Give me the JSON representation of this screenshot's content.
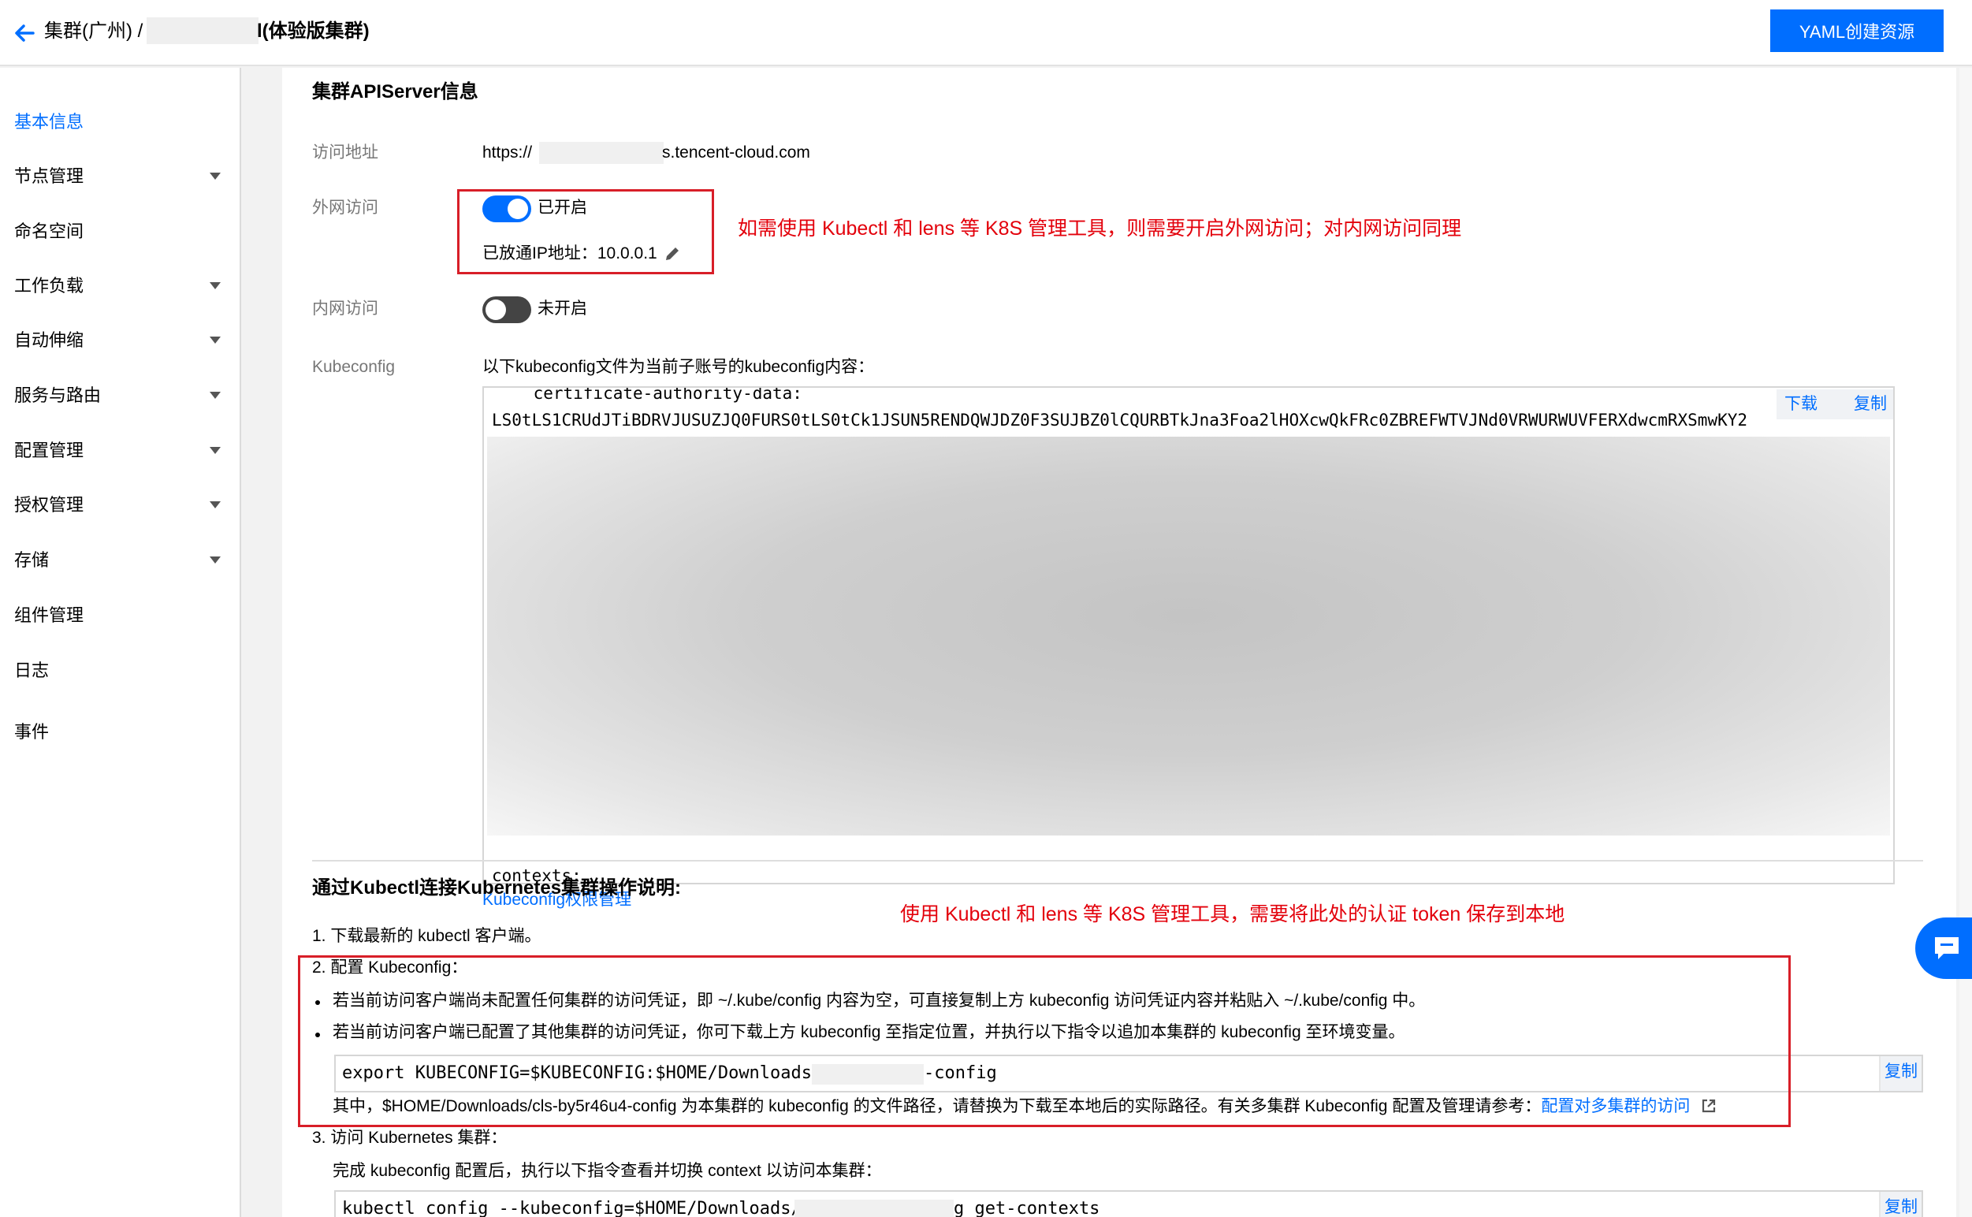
{
  "header": {
    "breadcrumb_prefix": "集群(广州) /",
    "cluster_title": "l(体验版集群)",
    "yaml_button": "YAML创建资源"
  },
  "sidebar": {
    "items": [
      {
        "label": "基本信息",
        "active": true,
        "expandable": false
      },
      {
        "label": "节点管理",
        "expandable": true
      },
      {
        "label": "命名空间",
        "expandable": false
      },
      {
        "label": "工作负载",
        "expandable": true
      },
      {
        "label": "自动伸缩",
        "expandable": true
      },
      {
        "label": "服务与路由",
        "expandable": true
      },
      {
        "label": "配置管理",
        "expandable": true
      },
      {
        "label": "授权管理",
        "expandable": true
      },
      {
        "label": "存储",
        "expandable": true
      },
      {
        "label": "组件管理",
        "expandable": false
      },
      {
        "label": "日志",
        "expandable": false
      },
      {
        "label": "事件",
        "expandable": false
      }
    ]
  },
  "apiserver": {
    "title": "集群APIServer信息",
    "access_label": "访问地址",
    "access_prefix": "https://",
    "access_suffix": "s.tencent-cloud.com",
    "public_label": "外网访问",
    "public_status": "已开启",
    "public_enabled": true,
    "allowed_ip": "已放通IP地址：10.0.0.1",
    "private_label": "内网访问",
    "private_status": "未开启",
    "private_enabled": false,
    "kubeconfig_label": "Kubeconfig",
    "kubeconfig_desc": "以下kubeconfig文件为当前子账号的kubeconfig内容：",
    "kubeconfig_line1": "    certificate-authority-data:",
    "kubeconfig_line2": "LS0tLS1CRUdJTiBDRVJUSUZJQ0FURS0tLS0tCk1JSUN5RENDQWJDZ0F3SUJBZ0lCQURBTkJna3Foa2lHOXcwQkFRc0ZBREFWTVJNd0VRWURWUVFERXdwcmRXSmwKY2",
    "kubeconfig_line_last": "contexts:",
    "download": "下载",
    "copy": "复制",
    "perm_link": "Kubeconfig权限管理"
  },
  "annotations": {
    "note1": "如需使用 Kubectl 和 lens 等 K8S 管理工具，则需要开启外网访问；对内网访问同理",
    "note2": "使用 Kubectl 和 lens 等 K8S 管理工具，需要将此处的认证 token 保存到本地"
  },
  "guide": {
    "title": "通过Kubectl连接Kubernetes集群操作说明:",
    "step1": "1. 下载最新的 kubectl 客户端。",
    "step2": "2. 配置 Kubeconfig：",
    "bullet1": "若当前访问客户端尚未配置任何集群的访问凭证，即 ~/.kube/config 内容为空，可直接复制上方 kubeconfig 访问凭证内容并粘贴入 ~/.kube/config 中。",
    "bullet2": "若当前访问客户端已配置了其他集群的访问凭证，你可下载上方 kubeconfig 至指定位置，并执行以下指令以追加本集群的 kubeconfig 至环境变量。",
    "cmd1_prefix": "export KUBECONFIG=$KUBECONFIG:$HOME/Downloads/",
    "cmd1_suffix": "-config",
    "copy": "复制",
    "note": "其中，$HOME/Downloads/cls-by5r46u4-config 为本集群的 kubeconfig 的文件路径，请替换为下载至本地后的实际路径。有关多集群 Kubeconfig 配置及管理请参考：",
    "note_link": "配置对多集群的访问",
    "step3": "3. 访问 Kubernetes 集群：",
    "step3_desc": "完成 kubeconfig 配置后，执行以下指令查看并切换 context 以访问本集群：",
    "cmd2_prefix": "kubectl config --kubeconfig=$HOME/Downloads/",
    "cmd2_suffix": "g get-contexts"
  },
  "colors": {
    "primary": "#006eff",
    "annotation_red": "#e3000b",
    "toggle_off": "#444444"
  }
}
